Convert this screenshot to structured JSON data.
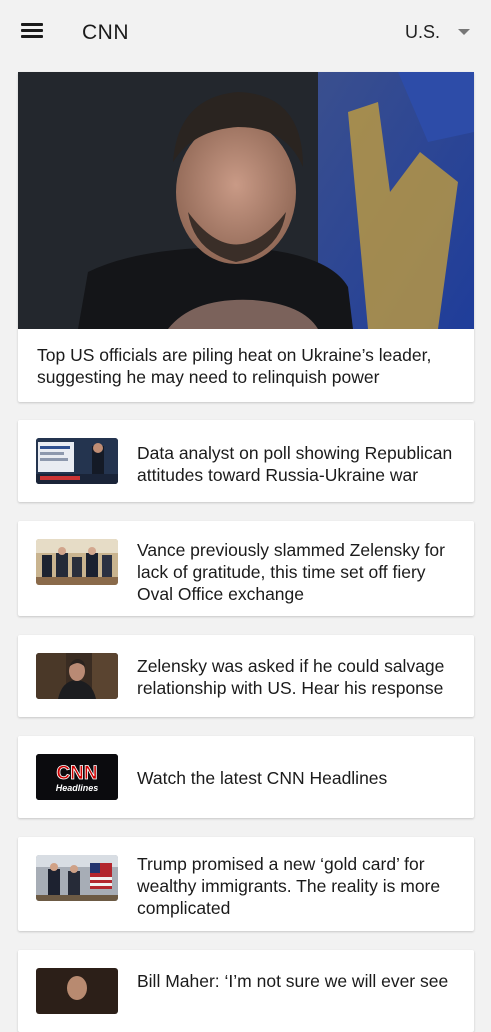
{
  "header": {
    "title": "CNN",
    "edition": "U.S.",
    "menu_icon": "hamburger-menu-icon",
    "dropdown_icon": "caret-down-icon"
  },
  "hero": {
    "headline": "Top US officials are piling heat on Ukraine’s leader, suggesting he may need to relinquish power"
  },
  "stories": [
    {
      "headline": "Data analyst on poll showing Republican attitudes toward Russia-Ukraine war"
    },
    {
      "headline": "Vance previously slammed Zelensky for lack of gratitude, this time set off fiery Oval Office exchange"
    },
    {
      "headline": "Zelensky was asked if he could salvage relationship with US. Hear his response"
    },
    {
      "headline": "Watch the latest CNN Headlines",
      "thumb_logo": "CNN",
      "thumb_logo_sub": "Headlines"
    },
    {
      "headline": "Trump promised a new ‘gold card’ for wealthy immigrants. The reality is more complicated"
    },
    {
      "headline": "Bill Maher: ‘I’m not sure we will ever see"
    }
  ],
  "colors": {
    "background": "#f2f2f2",
    "card": "#ffffff",
    "cnn_red": "#cc0000",
    "text": "#1b1b1b"
  }
}
